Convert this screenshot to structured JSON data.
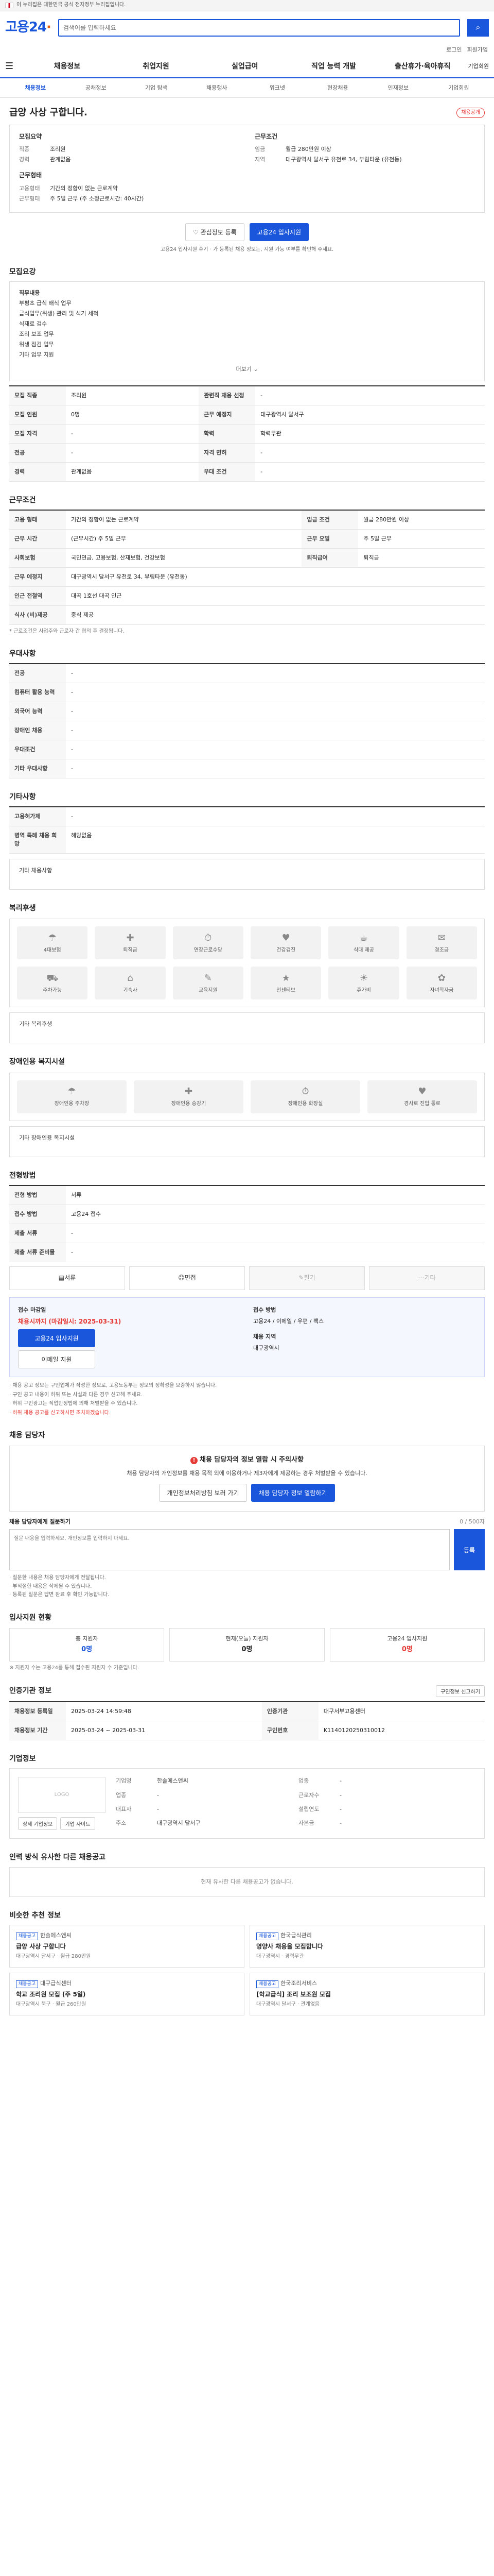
{
  "gov": {
    "text": "이 누리집은 대한민국 공식 전자정부 누리집입니다."
  },
  "header": {
    "logo": "고용24",
    "search_placeholder": "검색어를 입력하세요"
  },
  "util": [
    "로그인",
    "회원가입"
  ],
  "gnb": {
    "items": [
      "채용정보",
      "취업지원",
      "실업급여",
      "직업 능력 개발",
      "출산휴가·육아휴직"
    ],
    "right": "기업회원"
  },
  "subnav": [
    "채용정보",
    "공채정보",
    "기업 탐색",
    "채용행사",
    "워크넷",
    "현장채용",
    "인재정보",
    "기업회원"
  ],
  "title": "급양 사상 구합니다.",
  "title_badge": "채용공개",
  "summary": {
    "left_title": "모집요약",
    "left_kv": [
      [
        "직종",
        "조리원"
      ],
      [
        "경력",
        "관계없음"
      ]
    ],
    "right_title": "근무조건",
    "right_kv": [
      [
        "임금",
        "월급 280만원 이상"
      ],
      [
        "지역",
        "대구광역시 달서구 유천로 34, 부림타운 (유천동)"
      ]
    ],
    "org_title": "근무형태",
    "org_kv": [
      [
        "고용형태",
        "기간의 정함이 없는 근로계약"
      ],
      [
        "근무형태",
        "주 5일 근무 (주 소정근로시간: 40시간)"
      ]
    ]
  },
  "actions": {
    "scrap": "관심정보 등록",
    "apply": "고용24 입사지원"
  },
  "notice": "고용24 입사지원 후기 · 가 등록된 채용 정보는, 지원 가능 여부를 확인해 주세요.",
  "sections": {
    "recruit": "모집요강",
    "work": "근무조건",
    "pref": "우대사항",
    "other": "기타사항",
    "welfare": "복리후생",
    "disability": "장애인용 복지시설",
    "process": "전형방법",
    "apply_title": "채용 담당자",
    "qa_title": "채용 담당자 문의하기",
    "stat_title": "입사지원 현황",
    "info_title": "인증기관 정보",
    "company_title": "기업정보",
    "other_jobs": "인력 방식 유사한 다른 채용공고",
    "recommend": "비슷한 추천 정보"
  },
  "recruit_text": [
    "직무내용",
    "부평초 급식 배식 업무",
    "급식업무(위생) 관리 및 식기 세척",
    "식재료 검수",
    "조리 보조 업무",
    "위생 점검 업무",
    "기타 업무 지원"
  ],
  "recruit_more": "더보기",
  "recruit_table": [
    [
      "모집 직종",
      "조리원",
      "관련직 채용 선정",
      "-"
    ],
    [
      "모집 인원",
      "0명",
      "근무 예정지",
      "대구광역시 달서구"
    ],
    [
      "모집 자격",
      "-",
      "학력",
      "학력무관"
    ],
    [
      "전공",
      "-",
      "자격 면허",
      "-"
    ],
    [
      "경력",
      "관계없음",
      "우대 조건",
      "-"
    ]
  ],
  "work_table": [
    [
      "고용 형태",
      "기간의 정함이 없는 근로계약",
      "임금 조건",
      "월급 280만원 이상"
    ],
    [
      "근무 시간",
      "(근무시간) 주 5일 근무",
      "근무 요일",
      "주 5일 근무"
    ],
    [
      "사회보험",
      "국민연금, 고용보험, 산재보험, 건강보험",
      "퇴직급여",
      "퇴직금"
    ],
    [
      "근무 예정지",
      "대구광역시 달서구 유천로 34, 부림타운 (유천동)",
      "",
      ""
    ],
    [
      "인근 전철역",
      "대곡 1호선 대곡 인근",
      "",
      ""
    ],
    [
      "식사 (비)제공",
      "중식 제공",
      "",
      ""
    ]
  ],
  "work_note": "* 근로조건은 사업주와 근로자 간 협의 후 결정됩니다.",
  "pref_table": [
    [
      "전공",
      "-"
    ],
    [
      "컴퓨터 활용 능력",
      "-"
    ],
    [
      "외국어 능력",
      "-"
    ],
    [
      "장애인 채용",
      "-"
    ],
    [
      "우대조건",
      "-"
    ],
    [
      "기타 우대사항",
      "-"
    ]
  ],
  "other_table": [
    [
      "고용허가제",
      "-"
    ],
    [
      "병역 특례 채용 희망",
      "해당없음"
    ]
  ],
  "other_box_label": "기타 채용사항",
  "welfare_tiles": [
    "4대보험",
    "퇴직금",
    "연장근로수당",
    "건강검진",
    "식대 제공",
    "경조금",
    "주차가능",
    "기숙사",
    "교육지원",
    "인센티브",
    "휴가비",
    "자녀학자금"
  ],
  "welfare_box_label": "기타 복리후생",
  "disability_tiles": [
    "장애인용 주차장",
    "장애인용 승강기",
    "장애인용 화장실",
    "경사로 진입 통로"
  ],
  "disability_box_label": "기타 장애인용 복지시설",
  "process_table": [
    [
      "전형 방법",
      "서류"
    ],
    [
      "접수 방법",
      "고용24 접수"
    ],
    [
      "제출 서류",
      "-"
    ],
    [
      "제출 서류 준비물",
      "-"
    ]
  ],
  "process_steps": [
    "서류",
    "면접",
    "필기",
    "기타"
  ],
  "apply": {
    "col1_title": "접수 마감일",
    "deadline": "채용시까지 (마감일시: 2025-03-31)",
    "col2_title": "접수 방법",
    "col2_text": "고용24 / 이메일 / 우편 / 팩스",
    "col3_title": "채용 지역",
    "col3_text": "대구광역시",
    "btn_apply": "고용24 입사지원",
    "btn_email": "이메일 지원"
  },
  "apply_notes": [
    "· 채용 공고 정보는 구인업체가 작성한 정보로, 고용노동부는 정보의 정확성을 보증하지 않습니다.",
    "· 구인 공고 내용이 허위 또는 사실과 다른 경우 신고해 주세요.",
    "· 허위 구인광고는 직업안정법에 의해 처벌받을 수 있습니다."
  ],
  "apply_note_red": "· 허위 채용 공고를 신고하시면 조치하겠습니다.",
  "contact": {
    "title": "채용 담당자의 정보 열람 시 주의사항",
    "desc": "채용 담당자의 개인정보를 채용 목적 외에 이용하거나 제3자에게 제공하는 경우 처벌받을 수 있습니다.",
    "btn1": "개인정보처리방침 보러 가기",
    "btn2": "채용 담당자 정보 열람하기"
  },
  "qa": {
    "label": "채용 담당자에게 질문하기",
    "count": "0 / 500자",
    "placeholder": "질문 내용을 입력하세요. 개인정보를 입력하지 마세요.",
    "submit": "등록",
    "notes": [
      "· 질문한 내용은 채용 담당자에게 전달됩니다.",
      "· 부적절한 내용은 삭제될 수 있습니다.",
      "· 등록된 질문은 답변 완료 후 확인 가능합니다."
    ]
  },
  "stats": [
    [
      "총 지원자",
      "0명"
    ],
    [
      "현재(오늘) 지원자",
      "0명"
    ],
    [
      "고용24 입사지원",
      "0명"
    ]
  ],
  "stats_note": "※ 지원자 수는 고용24를 통해 접수된 지원자 수 기준입니다.",
  "info_table": [
    [
      "채용정보 등록일",
      "2025-03-24 14:59:48",
      "인증기관",
      "대구서부고용센터"
    ],
    [
      "채용정보 기간",
      "2025-03-24 ~ 2025-03-31",
      "구인번호",
      "K1140120250310012"
    ]
  ],
  "info_btn": "구인정보 신고하기",
  "company": {
    "logo": "LOGO",
    "btn1": "상세 기업정보",
    "btn2": "기업 사이트",
    "rows": [
      [
        "기업명",
        "한솔에스앤씨",
        "업종",
        "-"
      ],
      [
        "업종",
        "-",
        "근로자수",
        "-"
      ],
      [
        "대표자",
        "-",
        "설립연도",
        "-"
      ],
      [
        "주소",
        "대구광역시 달서구",
        "자본금",
        "-"
      ]
    ]
  },
  "other_empty": "현재 유사한 다른 채용공고가 없습니다.",
  "recs": [
    {
      "tag": "채용공고",
      "co": "한솔에스앤씨",
      "title": "급양 사상 구합니다",
      "meta": "대구광역시 달서구 · 월급 280만원"
    },
    {
      "tag": "채용공고",
      "co": "한국급식관리",
      "title": "영양사 채용을 모집합니다",
      "meta": "대구광역시 · 경력무관"
    },
    {
      "tag": "채용공고",
      "co": "대구급식센터",
      "title": "학교 조리원 모집 (주 5일)",
      "meta": "대구광역시 북구 · 월급 260만원"
    },
    {
      "tag": "채용공고",
      "co": "한국조리서비스",
      "title": "[학교급식] 조리 보조원 모집",
      "meta": "대구광역시 달서구 · 관계없음"
    }
  ]
}
